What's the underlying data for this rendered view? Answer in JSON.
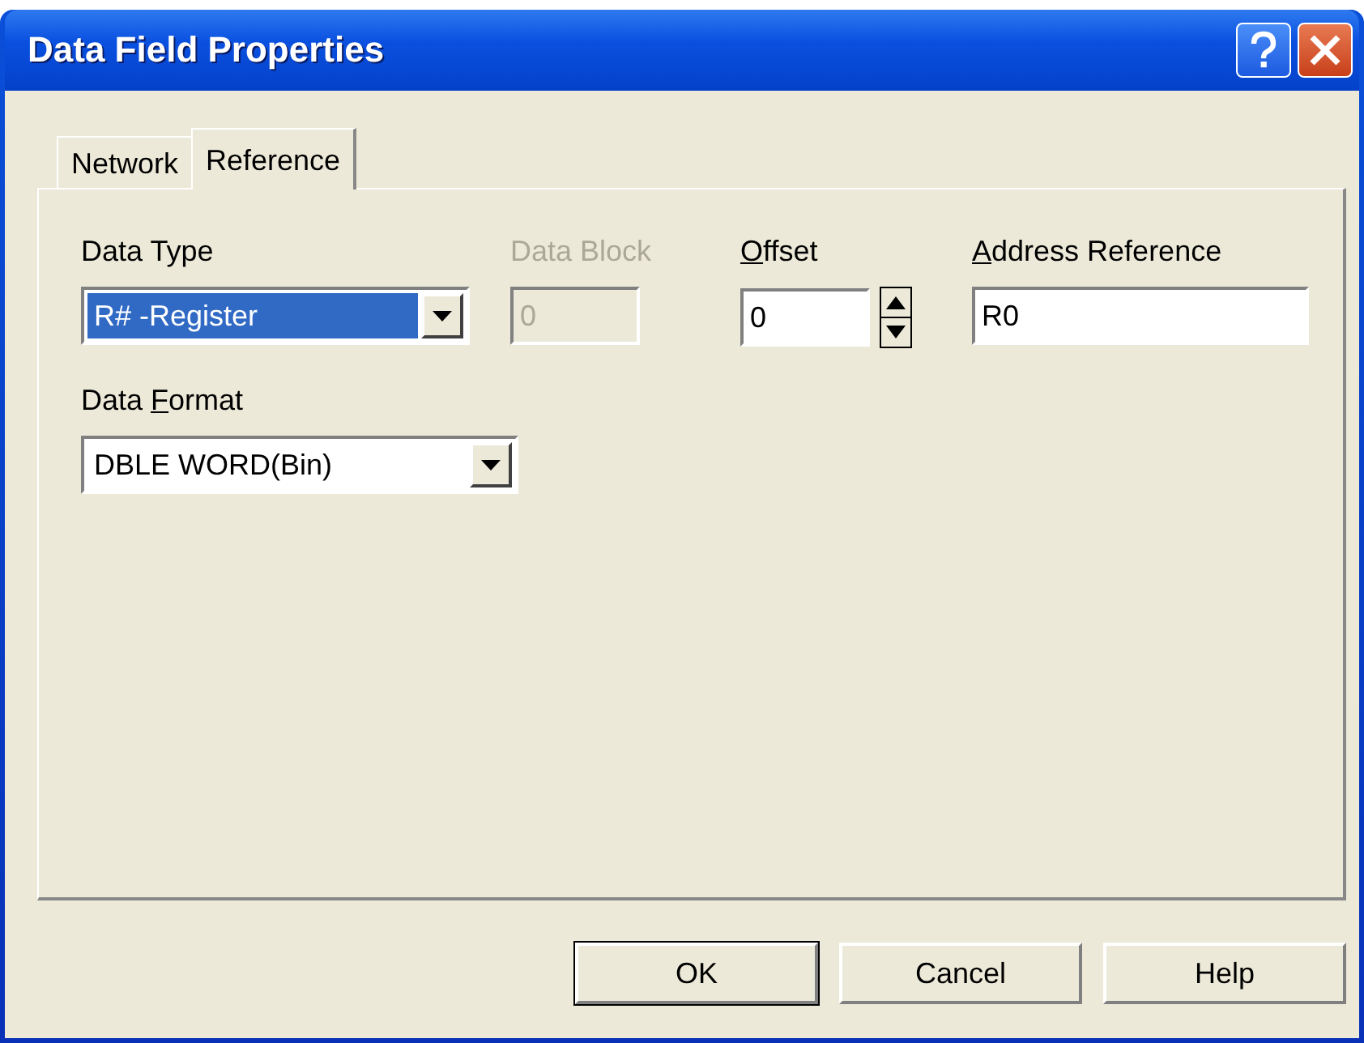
{
  "window": {
    "title": "Data Field Properties"
  },
  "tabs": [
    {
      "label": "Network",
      "selected": false
    },
    {
      "label": "Reference",
      "selected": true
    }
  ],
  "fields": [
    {
      "kind": "combo",
      "label": "Data Type",
      "value": "R# -Register",
      "highlighted": true,
      "disabled": false
    },
    {
      "kind": "text",
      "label": "Data Block",
      "value": "0",
      "disabled": true
    },
    {
      "kind": "spin",
      "label": [
        {
          "text": "O",
          "underlined": true
        },
        {
          "text": "ffset",
          "underlined": false
        }
      ],
      "value": "0",
      "disabled": false
    },
    {
      "kind": "text",
      "label": [
        {
          "text": "A",
          "underlined": true
        },
        {
          "text": "ddress Reference",
          "underlined": false
        }
      ],
      "value": "R0",
      "disabled": false
    },
    {
      "kind": "combo",
      "label": [
        {
          "text": "Data ",
          "underlined": false
        },
        {
          "text": "F",
          "underlined": true
        },
        {
          "text": "ormat",
          "underlined": false
        }
      ],
      "value": "DBLE WORD(Bin)",
      "highlighted": false,
      "disabled": false
    }
  ],
  "buttons": [
    {
      "label": "OK",
      "default": true
    },
    {
      "label": "Cancel",
      "default": false
    },
    {
      "label": "Help",
      "default": false
    }
  ]
}
